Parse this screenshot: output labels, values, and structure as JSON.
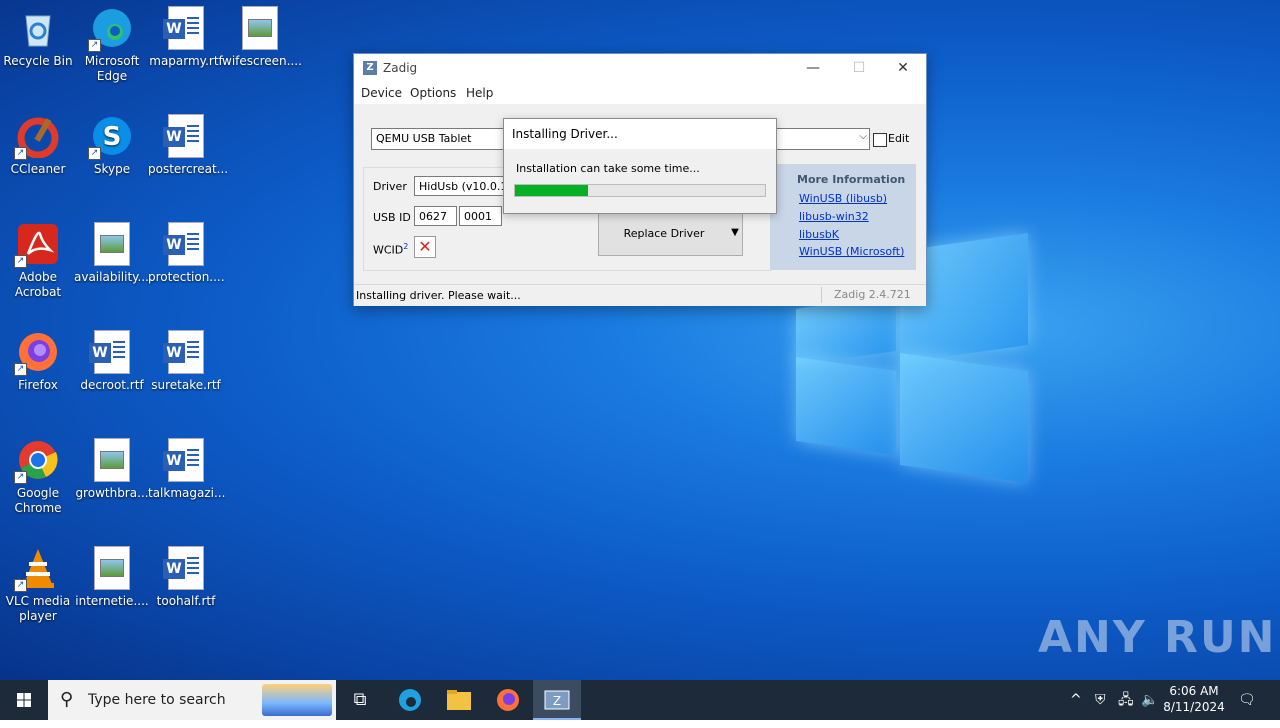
{
  "desktop": {
    "icons": [
      {
        "label": "Recycle Bin",
        "icon": "recycle-bin-icon"
      },
      {
        "label": "Microsoft Edge",
        "icon": "edge-icon"
      },
      {
        "label": "maparmy.rtf",
        "icon": "word-doc-icon"
      },
      {
        "label": "wifescreen....",
        "icon": "image-file-icon"
      },
      {
        "label": "CCleaner",
        "icon": "ccleaner-icon"
      },
      {
        "label": "Skype",
        "icon": "skype-icon"
      },
      {
        "label": "postercreat...",
        "icon": "word-doc-icon"
      },
      {
        "label": "Adobe Acrobat",
        "icon": "acrobat-icon"
      },
      {
        "label": "availability....",
        "icon": "image-file-icon"
      },
      {
        "label": "protection....",
        "icon": "word-doc-icon"
      },
      {
        "label": "Firefox",
        "icon": "firefox-icon"
      },
      {
        "label": "decroot.rtf",
        "icon": "word-doc-icon"
      },
      {
        "label": "suretake.rtf",
        "icon": "word-doc-icon"
      },
      {
        "label": "Google Chrome",
        "icon": "chrome-icon"
      },
      {
        "label": "growthbra...",
        "icon": "image-file-icon"
      },
      {
        "label": "talkmagazi...",
        "icon": "word-doc-icon"
      },
      {
        "label": "VLC media player",
        "icon": "vlc-icon"
      },
      {
        "label": "internetie....",
        "icon": "image-file-icon"
      },
      {
        "label": "toohalf.rtf",
        "icon": "word-doc-icon"
      }
    ],
    "watermark": "ANY RUN"
  },
  "zadig": {
    "title": "Zadig",
    "menu": [
      "Device",
      "Options",
      "Help"
    ],
    "device_selected": "QEMU USB Tablet",
    "edit_label": "Edit",
    "driver_label": "Driver",
    "driver_value": "HidUsb (v10.0.19",
    "usbid_label": "USB ID",
    "usbid_vid": "0627",
    "usbid_pid": "0001",
    "wcid_label": "WCID",
    "wcid_sup": "2",
    "replace_button": "Replace Driver",
    "more_info_heading": "More Information",
    "links": [
      "WinUSB (libusb)",
      "libusb-win32",
      "libusbK",
      "WinUSB (Microsoft)"
    ],
    "status": "Installing driver. Please wait...",
    "version": "Zadig 2.4.721"
  },
  "dialog": {
    "title": "Installing Driver...",
    "message": "Installation can take some time...",
    "progress": 0.29
  },
  "taskbar": {
    "search_placeholder": "Type here to search",
    "time": "6:06 AM",
    "date": "8/11/2024"
  },
  "colors": {
    "progress_fill": "#06b025",
    "link": "#0033cc",
    "wcid_x": "#dd2222"
  }
}
